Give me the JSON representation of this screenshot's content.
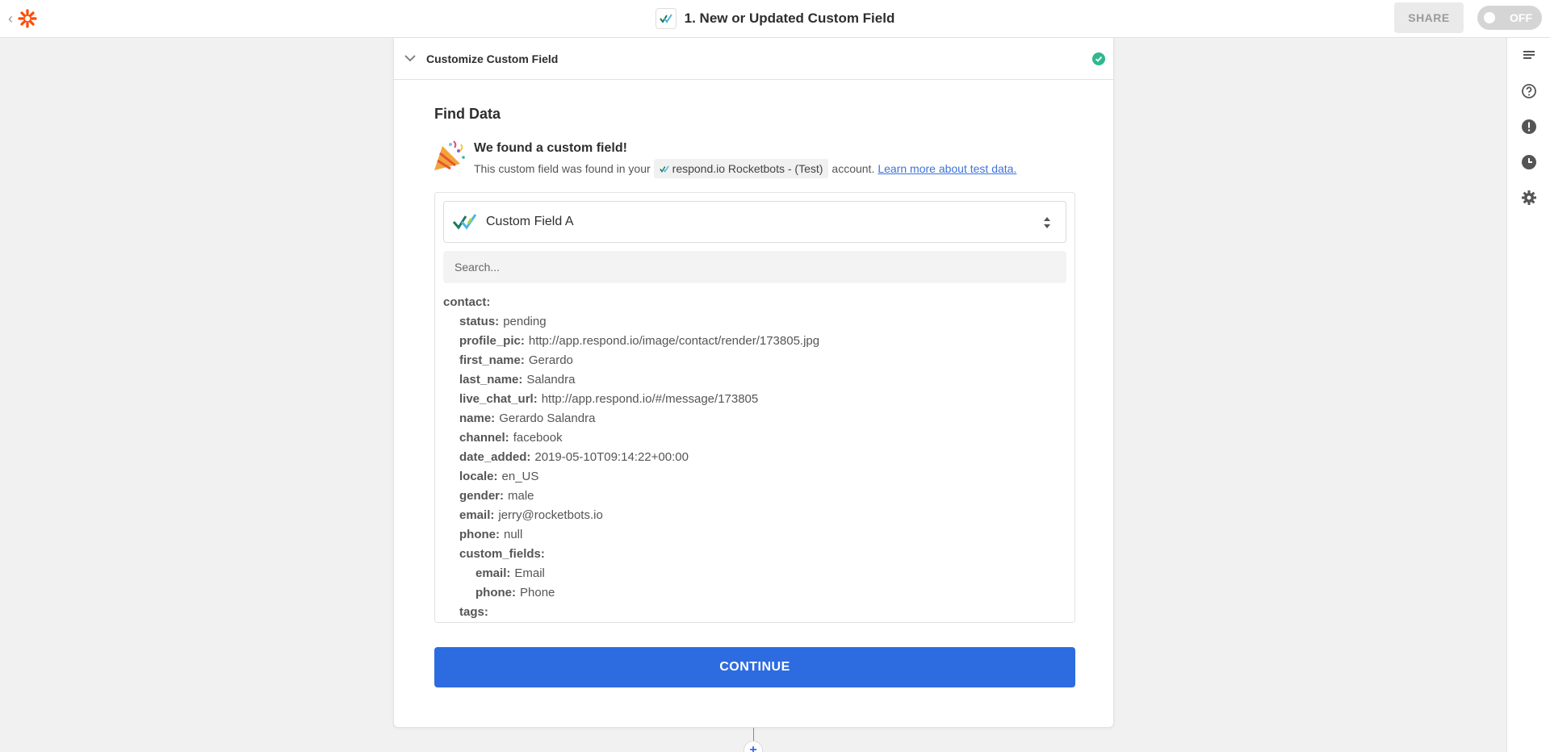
{
  "header": {
    "title": "1. New or Updated Custom Field",
    "share_label": "SHARE",
    "toggle_label": "OFF",
    "brand_color": "#ff4a00"
  },
  "section": {
    "title": "Customize Custom Field",
    "status": "complete"
  },
  "find_data": {
    "title": "Find Data",
    "found_title": "We found a custom field!",
    "found_prefix": "This custom field was found in your",
    "account_name": "respond.io Rocketbots - (Test)",
    "found_suffix": "account.",
    "learn_more": "Learn more about test data."
  },
  "select": {
    "value": "Custom Field A"
  },
  "search": {
    "placeholder": "Search..."
  },
  "tree": {
    "root": "contact:",
    "fields": [
      {
        "key": "status:",
        "value": "pending"
      },
      {
        "key": "profile_pic:",
        "value": "http://app.respond.io/image/contact/render/173805.jpg"
      },
      {
        "key": "first_name:",
        "value": "Gerardo"
      },
      {
        "key": "last_name:",
        "value": "Salandra"
      },
      {
        "key": "live_chat_url:",
        "value": "http://app.respond.io/#/message/173805"
      },
      {
        "key": "name:",
        "value": "Gerardo Salandra"
      },
      {
        "key": "channel:",
        "value": "facebook"
      },
      {
        "key": "date_added:",
        "value": "2019-05-10T09:14:22+00:00"
      },
      {
        "key": "locale:",
        "value": "en_US"
      },
      {
        "key": "gender:",
        "value": "male"
      },
      {
        "key": "email:",
        "value": "jerry@rocketbots.io"
      },
      {
        "key": "phone:",
        "value": "null"
      },
      {
        "key": "custom_fields:"
      }
    ],
    "custom_fields": [
      {
        "key": "email:",
        "value": "Email"
      },
      {
        "key": "phone:",
        "value": "Phone"
      }
    ],
    "tags_key": "tags:"
  },
  "continue_label": "CONTINUE",
  "add_step_label": "+",
  "colors": {
    "primary": "#2d6ce0",
    "success": "#2fb88f",
    "link": "#3e72d8"
  }
}
